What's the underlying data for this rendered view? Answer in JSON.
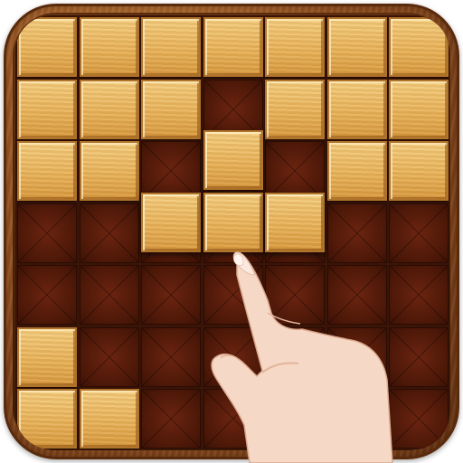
{
  "board": {
    "rows": 7,
    "cols": 7,
    "cells": [
      [
        1,
        1,
        1,
        1,
        1,
        1,
        1
      ],
      [
        1,
        1,
        1,
        0,
        1,
        1,
        1
      ],
      [
        1,
        1,
        0,
        0,
        0,
        1,
        1
      ],
      [
        0,
        0,
        0,
        0,
        0,
        0,
        0
      ],
      [
        0,
        0,
        0,
        0,
        0,
        0,
        0
      ],
      [
        1,
        0,
        0,
        0,
        0,
        0,
        0
      ],
      [
        1,
        1,
        0,
        0,
        0,
        0,
        0
      ]
    ],
    "colors": {
      "block": "#e9b45b",
      "empty_cell": "#4d1808",
      "frame": "#9c5522"
    }
  },
  "held_piece": {
    "shape": "T-piece",
    "cells": [
      [
        0,
        1,
        0
      ],
      [
        1,
        1,
        1
      ]
    ],
    "anchor_cell": {
      "row": 3,
      "col": 2
    }
  },
  "pointer": {
    "icon": "pointing-hand-icon"
  }
}
